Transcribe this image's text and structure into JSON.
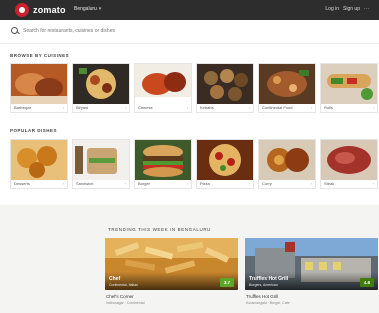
{
  "header": {
    "brand": "zomato",
    "city": "Bengaluru",
    "links": [
      "Log in",
      "Sign up",
      "···"
    ]
  },
  "search": {
    "placeholder": "Search for restaurants, cuisines or dishes"
  },
  "sections": {
    "cuisines": {
      "title": "Browse by cuisines",
      "items": [
        {
          "label": "Barbeque",
          "icon": "chevron-right"
        },
        {
          "label": "Biryani",
          "icon": "chevron-right"
        },
        {
          "label": "Chinese",
          "icon": "chevron-right"
        },
        {
          "label": "Kebabs",
          "icon": "chevron-right"
        },
        {
          "label": "Continental Food",
          "icon": "chevron-right"
        },
        {
          "label": "Rolls",
          "icon": "chevron-right"
        }
      ]
    },
    "dishes": {
      "title": "Popular dishes",
      "items": [
        {
          "label": "Desserts",
          "icon": "chevron-right"
        },
        {
          "label": "Sandwich",
          "icon": "chevron-right"
        },
        {
          "label": "Burger",
          "icon": "chevron-right"
        },
        {
          "label": "Pizza",
          "icon": "chevron-right"
        },
        {
          "label": "Curry",
          "icon": "chevron-right"
        },
        {
          "label": "Steak",
          "icon": "chevron-right"
        }
      ]
    }
  },
  "trending": {
    "title": "Trending this week in Bengaluru",
    "cards": [
      {
        "image_title": "Chef",
        "image_subtitle": "Continental, Italian",
        "rating": "3.7",
        "name": "Chef's Corner",
        "meta": "Indiranagar · Continental",
        "rating_color": "#5ba829"
      },
      {
        "image_title": "Truffles Hot Grill",
        "image_subtitle": "Burgers, American",
        "rating": "4.6",
        "name": "Truffles Hot Grill",
        "meta": "Koramangala · Burger, Cafe",
        "rating_color": "#3f7e00"
      }
    ]
  },
  "colors": {
    "brand_red": "#cb202d",
    "topbar": "#2d2d2d",
    "rating_green": "#5ba829"
  }
}
